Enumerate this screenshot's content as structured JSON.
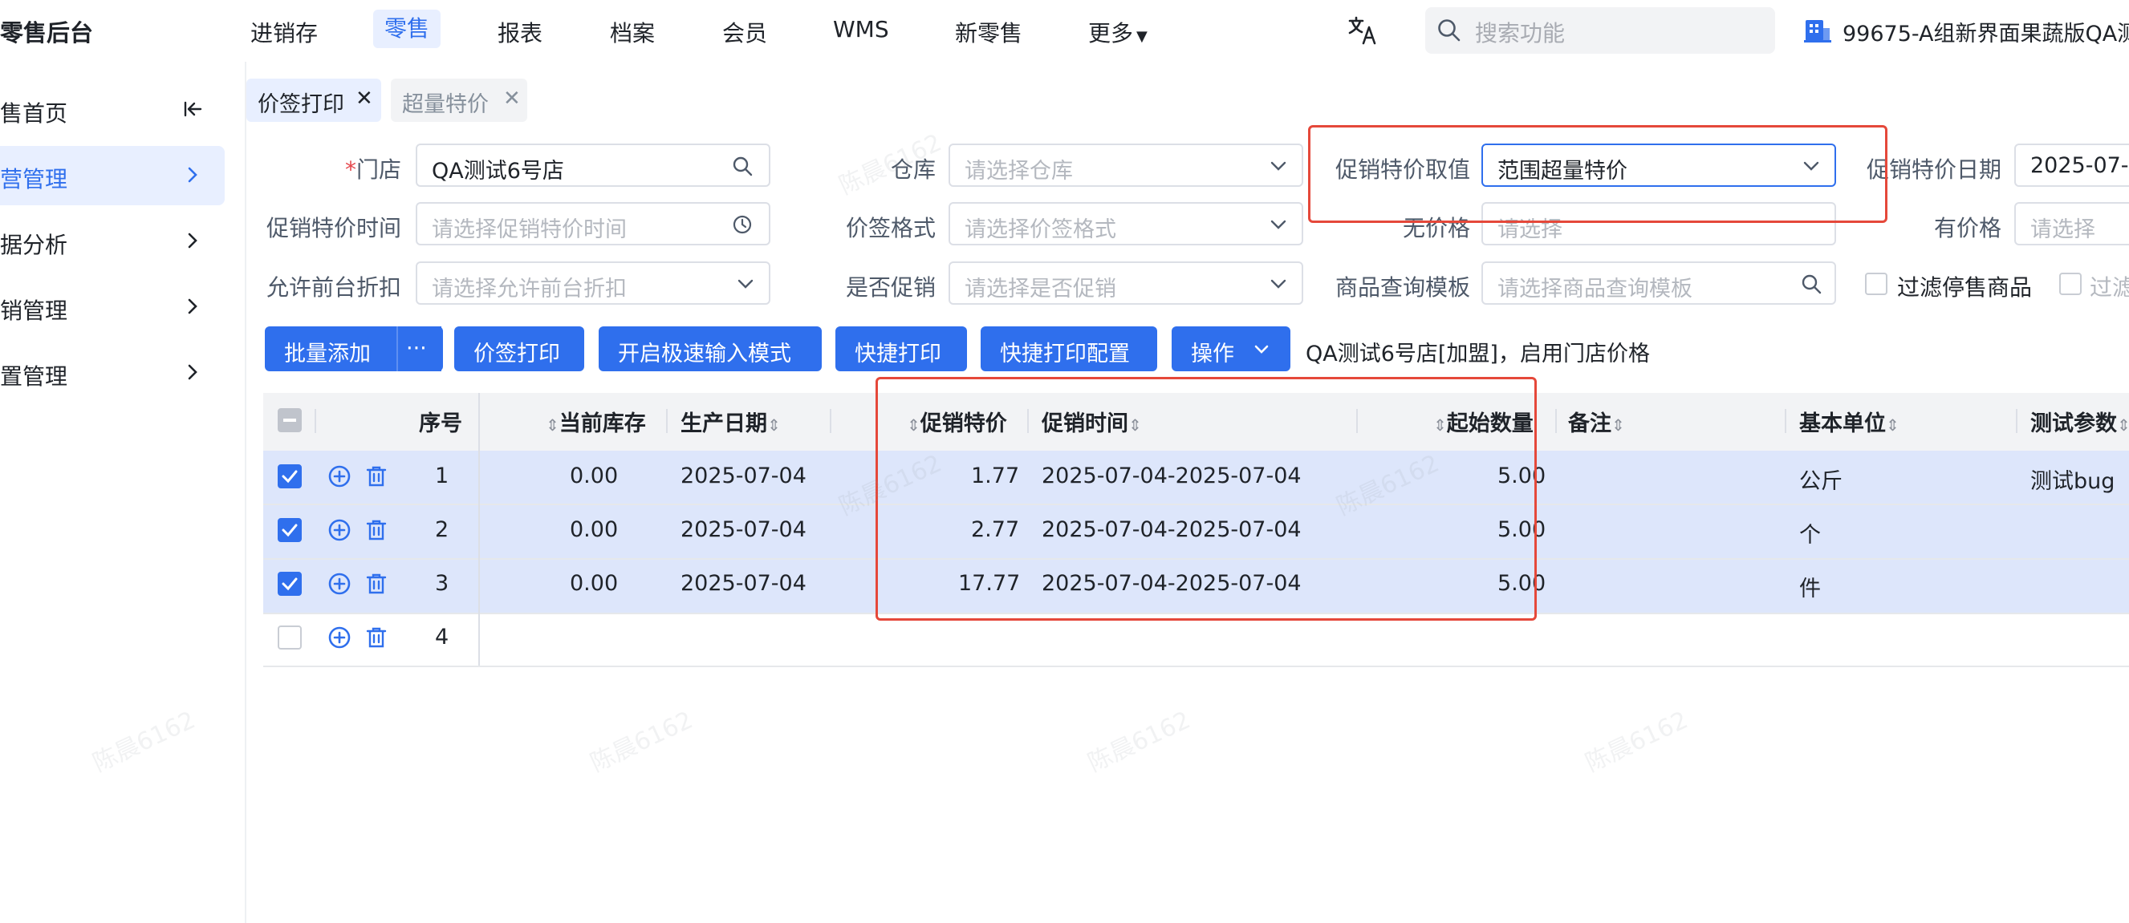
{
  "topbar": {
    "brand": "零售后台",
    "nav": [
      {
        "label": "进销存"
      },
      {
        "label": "零售"
      },
      {
        "label": "报表"
      },
      {
        "label": "档案"
      },
      {
        "label": "会员"
      },
      {
        "label": "WMS"
      },
      {
        "label": "新零售"
      },
      {
        "label": "更多"
      }
    ],
    "active_nav": "零售",
    "search_placeholder": "搜索功能",
    "store_name": "99675-A组新界面果蔬版QA测"
  },
  "sidebar": {
    "items": [
      {
        "label": "售首页"
      },
      {
        "label": "营管理"
      },
      {
        "label": "据分析"
      },
      {
        "label": "销管理"
      },
      {
        "label": "置管理"
      }
    ],
    "active_index": 1
  },
  "tabs": [
    {
      "label": "价签打印",
      "active": true
    },
    {
      "label": "超量特价",
      "active": false
    }
  ],
  "form": {
    "store": {
      "label": "门店",
      "required_mark": "*",
      "value": "QA测试6号店"
    },
    "warehouse": {
      "label": "仓库",
      "placeholder": "请选择仓库"
    },
    "promo_value": {
      "label": "促销特价取值",
      "value": "范围超量特价"
    },
    "promo_date": {
      "label": "促销特价日期",
      "value": "2025-07-0"
    },
    "promo_time": {
      "label": "促销特价时间",
      "placeholder": "请选择促销特价时间"
    },
    "price_tag_format": {
      "label": "价签格式",
      "placeholder": "请选择价签格式"
    },
    "no_price": {
      "label": "无价格",
      "placeholder": "请选择"
    },
    "has_price": {
      "label": "有价格",
      "placeholder": "请选择"
    },
    "allow_discount": {
      "label": "允许前台折扣",
      "placeholder": "请选择允许前台折扣"
    },
    "is_promo": {
      "label": "是否促销",
      "placeholder": "请选择是否促销"
    },
    "query_template": {
      "label": "商品查询模板",
      "placeholder": "请选择商品查询模板"
    },
    "filter_stopped": {
      "label": "过滤停售商品",
      "checked": false
    },
    "filter_other": {
      "label": "过滤",
      "checked": false
    }
  },
  "toolbar": {
    "batch_add": "批量添加",
    "more": "···",
    "print": "价签打印",
    "fast_input": "开启极速输入模式",
    "quick_print": "快捷打印",
    "quick_print_config": "快捷打印配置",
    "operation": "操作",
    "store_info": "QA测试6号店[加盟]，启用门店价格"
  },
  "table": {
    "columns": {
      "seq": "序号",
      "stock": "当前库存",
      "prod_date": "生产日期",
      "promo_price": "促销特价",
      "promo_time": "促销时间",
      "start_qty": "起始数量",
      "remark": "备注",
      "unit": "基本单位",
      "test_param": "测试参数"
    },
    "rows": [
      {
        "seq": "1",
        "checked": true,
        "stock": "0.00",
        "prod_date": "2025-07-04",
        "promo_price": "1.77",
        "promo_time": "2025-07-04-2025-07-04",
        "start_qty": "5.00",
        "remark": "",
        "unit": "公斤",
        "test_param": "测试bug"
      },
      {
        "seq": "2",
        "checked": true,
        "stock": "0.00",
        "prod_date": "2025-07-04",
        "promo_price": "2.77",
        "promo_time": "2025-07-04-2025-07-04",
        "start_qty": "5.00",
        "remark": "",
        "unit": "个",
        "test_param": ""
      },
      {
        "seq": "3",
        "checked": true,
        "stock": "0.00",
        "prod_date": "2025-07-04",
        "promo_price": "17.77",
        "promo_time": "2025-07-04-2025-07-04",
        "start_qty": "5.00",
        "remark": "",
        "unit": "件",
        "test_param": ""
      },
      {
        "seq": "4",
        "checked": false,
        "stock": "",
        "prod_date": "",
        "promo_price": "",
        "promo_time": "",
        "start_qty": "",
        "remark": "",
        "unit": "",
        "test_param": ""
      }
    ]
  },
  "watermark": "陈晨6162",
  "colors": {
    "accent": "#2f6fed",
    "selected_row": "#dde6fb",
    "highlight_box": "#e5483a"
  }
}
